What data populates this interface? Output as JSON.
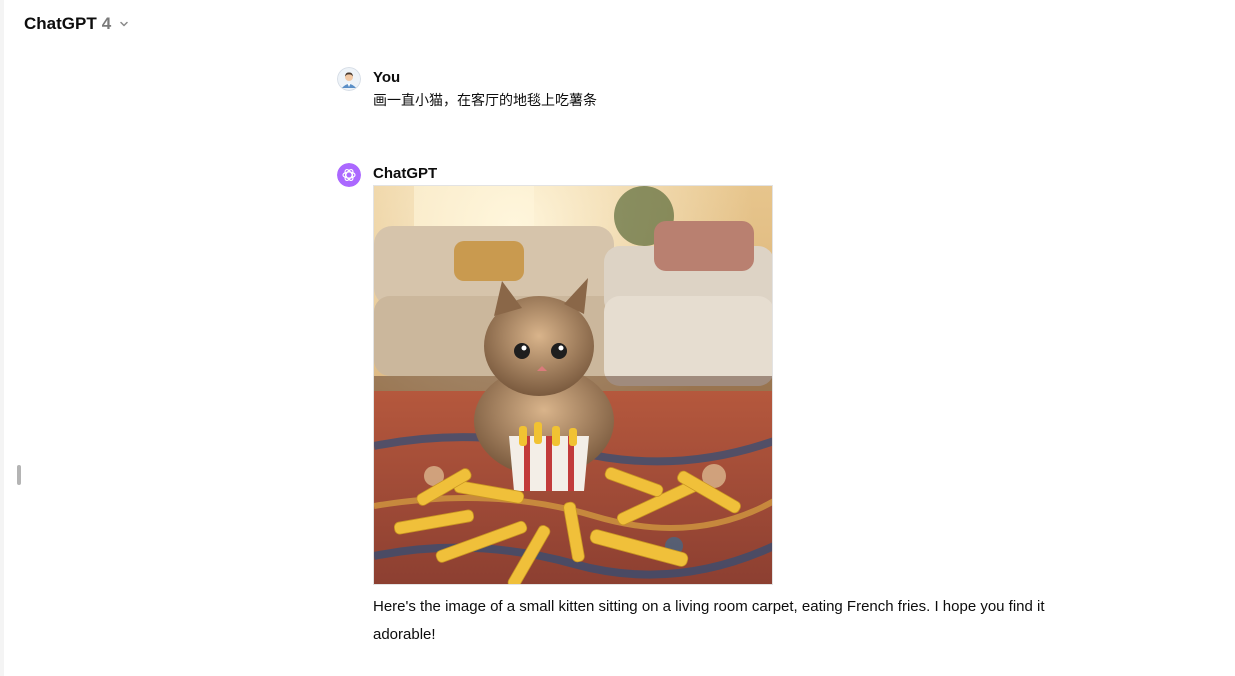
{
  "header": {
    "model_name": "ChatGPT",
    "model_version": "4",
    "dropdown_icon": "chevron-down-icon"
  },
  "messages": [
    {
      "author": "You",
      "avatar_icon": "user-avatar-icon",
      "text": "画一直小猫，在客厅的地毯上吃薯条"
    },
    {
      "author": "ChatGPT",
      "avatar_icon": "openai-logo-icon",
      "image_subject": "kitten-eating-fries-icon",
      "text": "Here's the image of a small kitten sitting on a living room carpet, eating French fries. I hope you find it adorable!"
    }
  ],
  "colors": {
    "assistant_avatar": "#ab68ff",
    "text": "#0d0d0d",
    "muted": "#7a7a7a"
  }
}
